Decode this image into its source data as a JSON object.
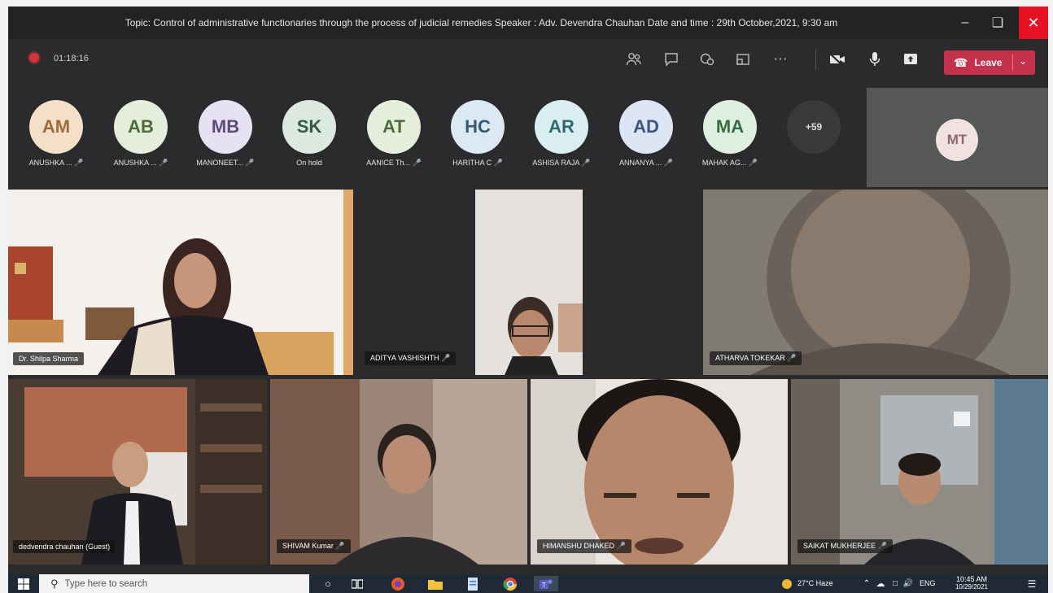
{
  "window": {
    "title": "Topic: Control of administrative functionaries through the process of judicial remedies Speaker : Adv. Devendra Chauhan Date and time : 29th October,2021, 9:30 am"
  },
  "meeting": {
    "timer": "01:18:16",
    "leave_label": "Leave"
  },
  "participants": [
    {
      "initials": "AM",
      "name": "ANUSHKA ...",
      "bg": "#f4e0c8",
      "fg": "#9a6b3e"
    },
    {
      "initials": "AB",
      "name": "ANUSHKA ...",
      "bg": "#e4eedb",
      "fg": "#4d6b3a"
    },
    {
      "initials": "MB",
      "name": "MANONEET...",
      "bg": "#e7e2f2",
      "fg": "#5b4d7a"
    },
    {
      "initials": "SK",
      "name": "On hold",
      "bg": "#dce9e1",
      "fg": "#355a45"
    },
    {
      "initials": "AT",
      "name": "AANICE Th...",
      "bg": "#e4eedb",
      "fg": "#4d6b3a"
    },
    {
      "initials": "HC",
      "name": "HARITHA C",
      "bg": "#dbe9f2",
      "fg": "#365a73"
    },
    {
      "initials": "AR",
      "name": "ASHISA RAJA",
      "bg": "#d9eef0",
      "fg": "#2f6870"
    },
    {
      "initials": "AD",
      "name": "ANNANYA ...",
      "bg": "#dde6f4",
      "fg": "#3d5480"
    },
    {
      "initials": "MA",
      "name": "MAHAK AG...",
      "bg": "#def0e0",
      "fg": "#3a6b42"
    }
  ],
  "overflow_count": "+59",
  "self_view": {
    "initials": "MT"
  },
  "video_tiles": [
    {
      "name": "Dr. Shilpa Sharma"
    },
    {
      "name": "ADITYA VASHISHTH"
    },
    {
      "name": "ATHARVA TOKEKAR"
    },
    {
      "name": "dedvendra chauhan (Guest)"
    },
    {
      "name": "SHIVAM Kumar"
    },
    {
      "name": "HIMANSHU DHAKED"
    },
    {
      "name": "SAIKAT MUKHERJEE"
    }
  ],
  "taskbar": {
    "search_placeholder": "Type here to search",
    "weather": "27°C  Haze",
    "language": "ENG",
    "time": "10:45 AM",
    "date": "10/29/2021"
  }
}
